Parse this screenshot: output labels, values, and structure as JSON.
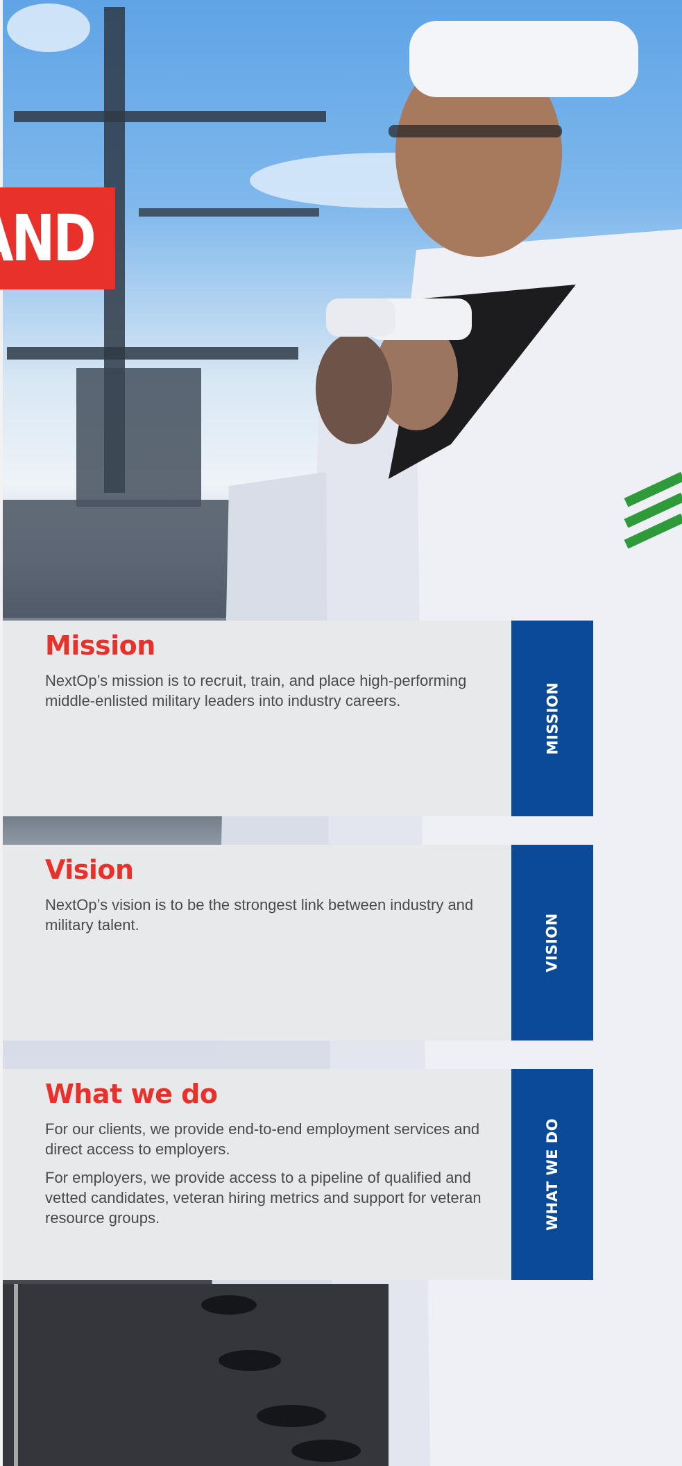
{
  "brand": {
    "tag_text": "AND",
    "accent_color": "#e8312a",
    "tab_color": "#0b4a96"
  },
  "cards": {
    "mission": {
      "title": "Mission",
      "paragraphs": [
        "NextOp’s mission is to recruit, train, and place high-performing middle-enlisted military leaders into industry careers."
      ],
      "tab_label": "MISSION"
    },
    "vision": {
      "title": "Vision",
      "paragraphs": [
        "NextOp’s vision is to be the strongest link between industry and military talent."
      ],
      "tab_label": "VISION"
    },
    "whatwedo": {
      "title": "What we do",
      "paragraphs": [
        "For our clients, we provide end-to-end employment services and direct access to employers.",
        "For employers, we provide access to a pipeline of qualified and vetted candidates, veteran hiring metrics and support for veteran resource groups."
      ],
      "tab_label": "WHAT WE DO"
    }
  }
}
